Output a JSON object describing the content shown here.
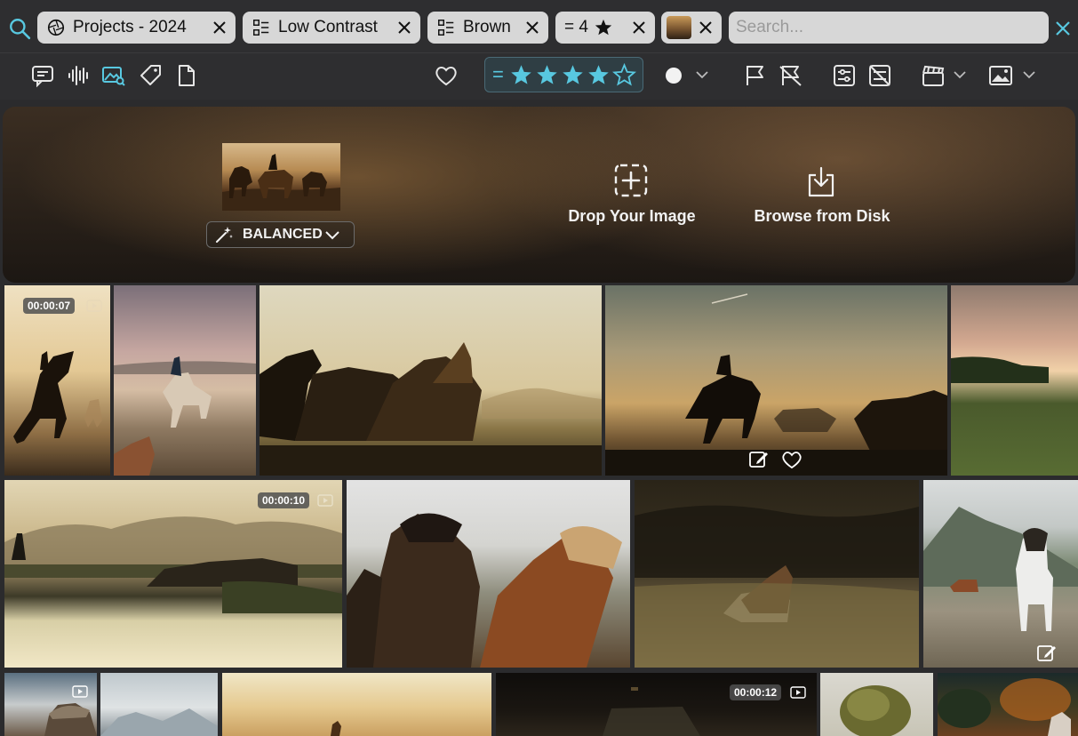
{
  "search_row": {
    "chips": [
      {
        "label": "Projects - 2024",
        "icon": "aperture-icon"
      },
      {
        "label": "Low Contrast",
        "icon": "filter-icon"
      },
      {
        "label": "Brown",
        "icon": "filter-icon"
      },
      {
        "label": "= 4",
        "icon": "star-icon"
      },
      {
        "label": "",
        "icon": "image-thumbnail"
      }
    ],
    "search_placeholder": "Search..."
  },
  "toolbar": {
    "rating_prefix": "=",
    "rating_value": 4,
    "rating_max": 5,
    "accent_color": "#58c8e0"
  },
  "hero": {
    "mode_label": "BALANCED",
    "drop_label": "Drop Your Image",
    "browse_label": "Browse from Disk"
  },
  "grid": {
    "badges": {
      "t1": "00:00:07",
      "t6": "00:00:10",
      "t13": "00:00:12"
    }
  }
}
